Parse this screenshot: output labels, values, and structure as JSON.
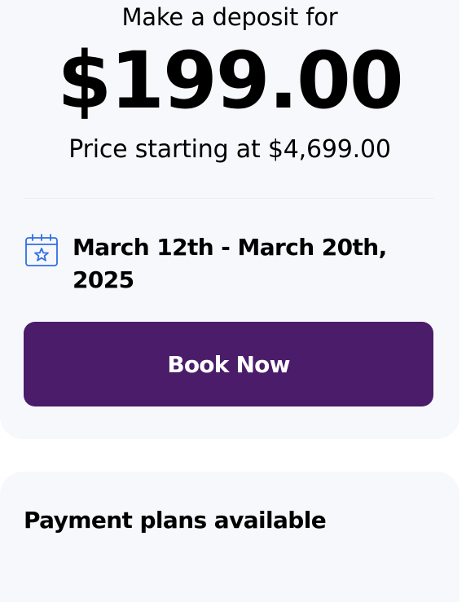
{
  "deposit": {
    "label": "Make a deposit for",
    "amount": "$199.00",
    "price_starting": "Price starting at $4,699.00"
  },
  "trip": {
    "dates": "March 12th - March 20th, 2025",
    "icon": "calendar-star-icon"
  },
  "actions": {
    "book_label": "Book Now"
  },
  "payment": {
    "heading": "Payment plans available"
  },
  "colors": {
    "accent": "#4a1c69",
    "icon": "#2f6fe4",
    "card_bg": "#f7f8fb"
  }
}
